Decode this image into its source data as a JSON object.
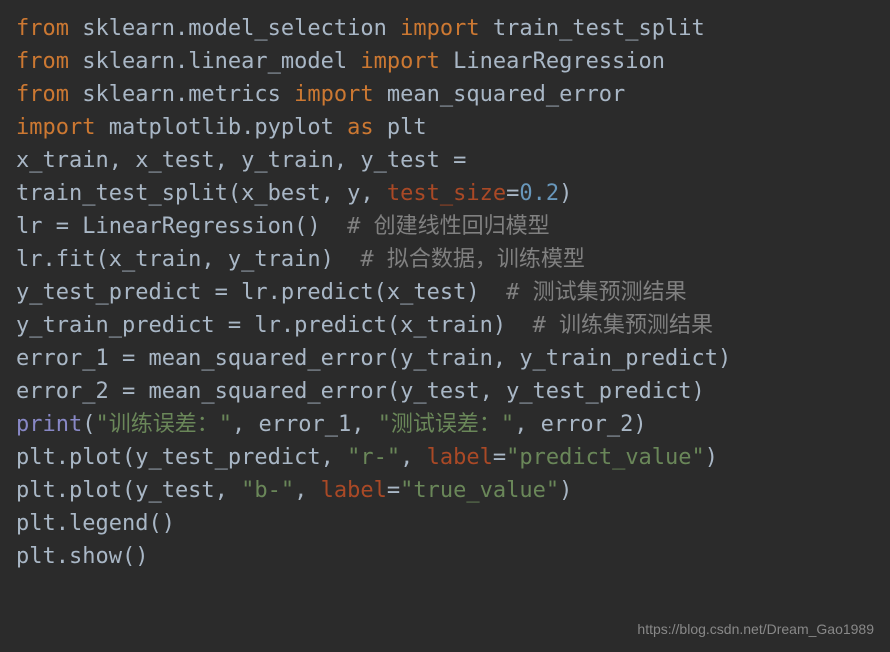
{
  "code": {
    "line1": {
      "from": "from",
      "mod": " sklearn.model_selection ",
      "imp": "import",
      "name": " train_test_split"
    },
    "line2": {
      "from": "from",
      "mod": " sklearn.linear_model ",
      "imp": "import",
      "name": " LinearRegression"
    },
    "line3": {
      "from": "from",
      "mod": " sklearn.metrics ",
      "imp": "import",
      "name": " mean_squared_error"
    },
    "line4": {
      "imp": "import",
      "mod": " matplotlib.pyplot ",
      "as": "as",
      "alias": " plt"
    },
    "line5": "x_train, x_test, y_train, y_test = ",
    "line6": {
      "pre": "train_test_split(x_best, y, ",
      "arg": "test_size",
      "post": "=",
      "num": "0.2",
      "end": ")"
    },
    "line7": {
      "code": "lr = LinearRegression()  ",
      "comment": "# 创建线性回归模型"
    },
    "line8": {
      "code": "lr.fit(x_train, y_train)  ",
      "comment": "# 拟合数据，训练模型"
    },
    "line9": {
      "code": "y_test_predict = lr.predict(x_test)  ",
      "comment": "# 测试集预测结果"
    },
    "line10": {
      "code": "y_train_predict = lr.predict(x_train)  ",
      "comment": "# 训练集预测结果"
    },
    "line11": "error_1 = mean_squared_error(y_train, y_train_predict)",
    "line12": "error_2 = mean_squared_error(y_test, y_test_predict)",
    "line13": {
      "fn": "print",
      "p1": "(",
      "s1": "\"训练误差：\"",
      "c1": ", error_1, ",
      "s2": "\"测试误差：\"",
      "c2": ", error_2)"
    },
    "line14": {
      "pre": "plt.plot(y_test_predict, ",
      "s1": "\"r-\"",
      "c1": ", ",
      "arg": "label",
      "eq": "=",
      "s2": "\"predict_value\"",
      "end": ")"
    },
    "line15": {
      "pre": "plt.plot(y_test, ",
      "s1": "\"b-\"",
      "c1": ", ",
      "arg": "label",
      "eq": "=",
      "s2": "\"true_value\"",
      "end": ")"
    },
    "line16": "plt.legend()",
    "line17": "plt.show()"
  },
  "watermark": "https://blog.csdn.net/Dream_Gao1989"
}
